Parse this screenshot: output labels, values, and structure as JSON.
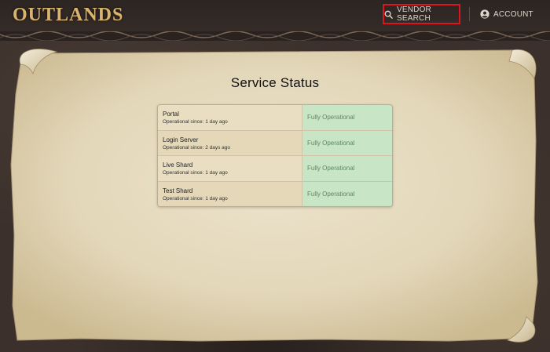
{
  "header": {
    "logo_text": "OUTLANDS",
    "vendor_search_label": "VENDOR SEARCH",
    "account_label": "ACCOUNT"
  },
  "main": {
    "title": "Service Status",
    "services": [
      {
        "name": "Portal",
        "since": "Operational since: 1 day ago",
        "status": "Fully Operational"
      },
      {
        "name": "Login Server",
        "since": "Operational since: 2 days ago",
        "status": "Fully Operational"
      },
      {
        "name": "Live Shard",
        "since": "Operational since: 1 day ago",
        "status": "Fully Operational"
      },
      {
        "name": "Test Shard",
        "since": "Operational since: 1 day ago",
        "status": "Fully Operational"
      }
    ]
  },
  "colors": {
    "highlight_border": "#e0141c",
    "status_bg": "#c8e5c6",
    "status_text": "#5e8a5e",
    "parchment": "#e6dcc2",
    "header_bg": "#2c2522",
    "logo_gold": "#d8b472"
  },
  "icons": {
    "vendor_search": "search-icon",
    "account": "user-circle-icon"
  }
}
